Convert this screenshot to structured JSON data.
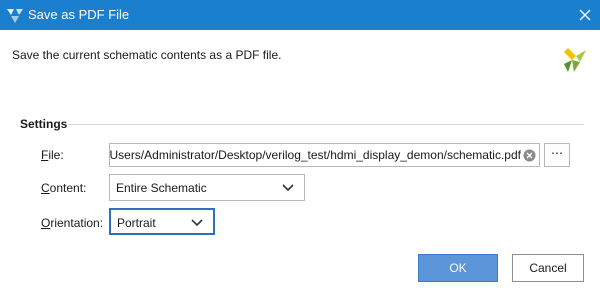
{
  "window": {
    "title": "Save as PDF File",
    "accent_color": "#1b7fcf",
    "app_icon": "xilinx-logo-icon",
    "close_icon": "close-icon"
  },
  "header": {
    "description": "Save the current schematic contents as a PDF file.",
    "logo": "xilinx-logo-icon"
  },
  "settings": {
    "title": "Settings",
    "file": {
      "label_mnemonic": "F",
      "label_rest": "ile:",
      "value": "C:/Users/Administrator/Desktop/verilog_test/hdmi_display_demon/schematic.pdf",
      "clear_icon": "clear-icon",
      "browse_label": "⋯"
    },
    "content": {
      "label_mnemonic": "C",
      "label_rest": "ontent:",
      "selected": "Entire Schematic"
    },
    "orientation": {
      "label_mnemonic": "O",
      "label_rest": "rientation:",
      "selected": "Portrait"
    }
  },
  "buttons": {
    "ok": "OK",
    "cancel": "Cancel"
  }
}
